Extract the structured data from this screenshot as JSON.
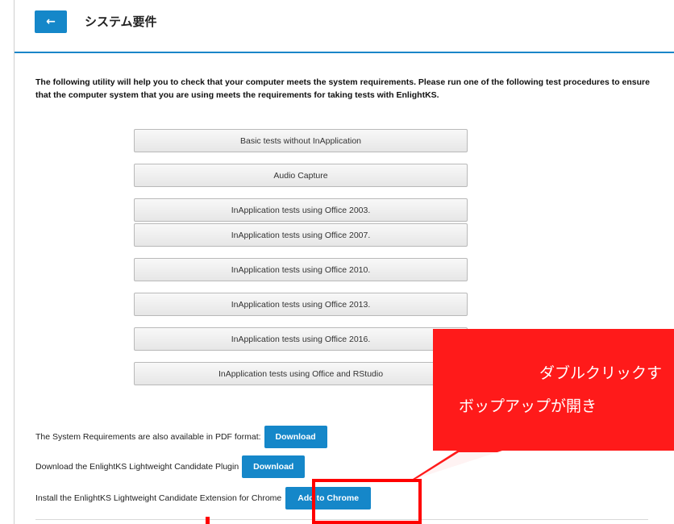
{
  "header": {
    "back_icon": "left-arrow-icon",
    "back_glyph": "←",
    "title": "システム要件"
  },
  "intro": {
    "text": "The following utility will help you to check that your computer meets the system requirements. Please run one of the following test procedures to ensure that the computer system that you are using meets the requirements for taking tests with EnlightKS."
  },
  "tests": [
    {
      "label": "Basic tests without InApplication"
    },
    {
      "label": "Audio Capture"
    },
    {
      "label": "InApplication tests using Office 2003."
    },
    {
      "label": "InApplication tests using Office 2007."
    },
    {
      "label": "InApplication tests using Office 2010."
    },
    {
      "label": "InApplication tests using Office 2013."
    },
    {
      "label": "InApplication tests using Office 2016."
    },
    {
      "label": "InApplication tests using Office and RStudio"
    }
  ],
  "downloads": {
    "pdf_text": "The System Requirements are also available in PDF format:",
    "pdf_button": "Download",
    "plugin_text": "Download the EnlightKS Lightweight Candidate Plugin",
    "plugin_button": "Download",
    "extension_text": "Install the EnlightKS Lightweight Candidate Extension for Chrome",
    "extension_button": "Add to Chrome"
  },
  "callout": {
    "line1": "ダブルクリックす",
    "line2": "ボップアップが開き"
  },
  "colors": {
    "accent": "#1587c9",
    "callout": "#ff1a1a"
  }
}
